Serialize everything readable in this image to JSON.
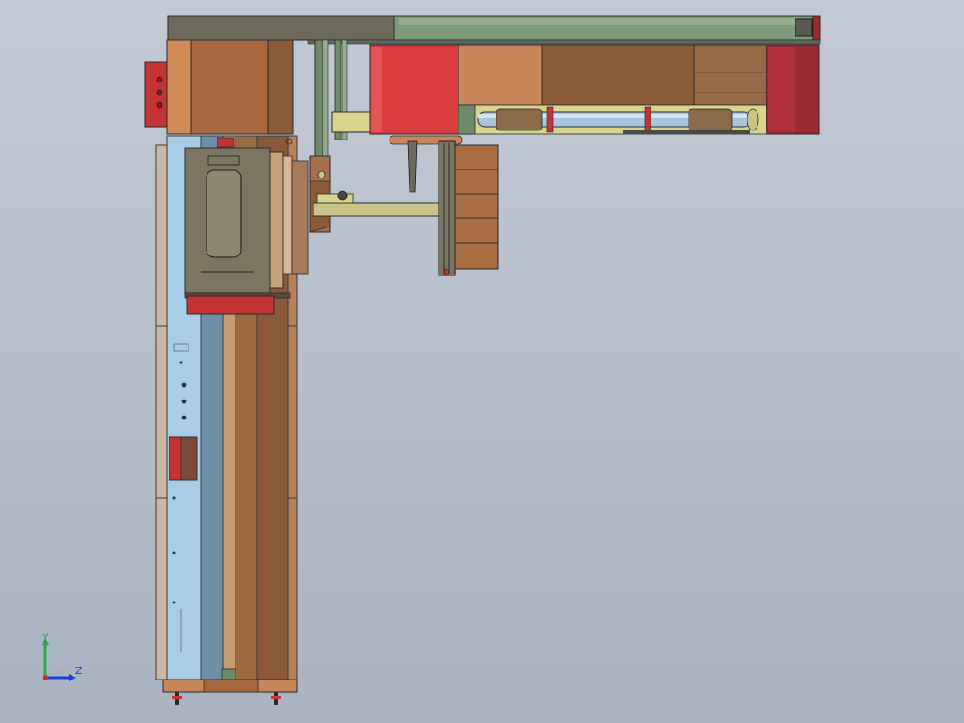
{
  "viewport": {
    "background_top": "#c3cad5",
    "background_bottom": "#a9b3c1"
  },
  "model_colors": {
    "copper": "#c8875a",
    "brown": "#8a5a3a",
    "red": "#d43a3a",
    "dark_red": "#8a1e24",
    "green_gray": "#6e8a6a",
    "light_blue": "#a9cde6",
    "steel_blue": "#6d8fa8",
    "khaki": "#c9c58a",
    "dark_gray": "#6e6a5c"
  },
  "orientation_triad": {
    "y_label": "Y",
    "z_label": "Z",
    "y_color": "#2da84a",
    "z_color": "#1f3fd8",
    "x_color": "#d02a2a"
  }
}
